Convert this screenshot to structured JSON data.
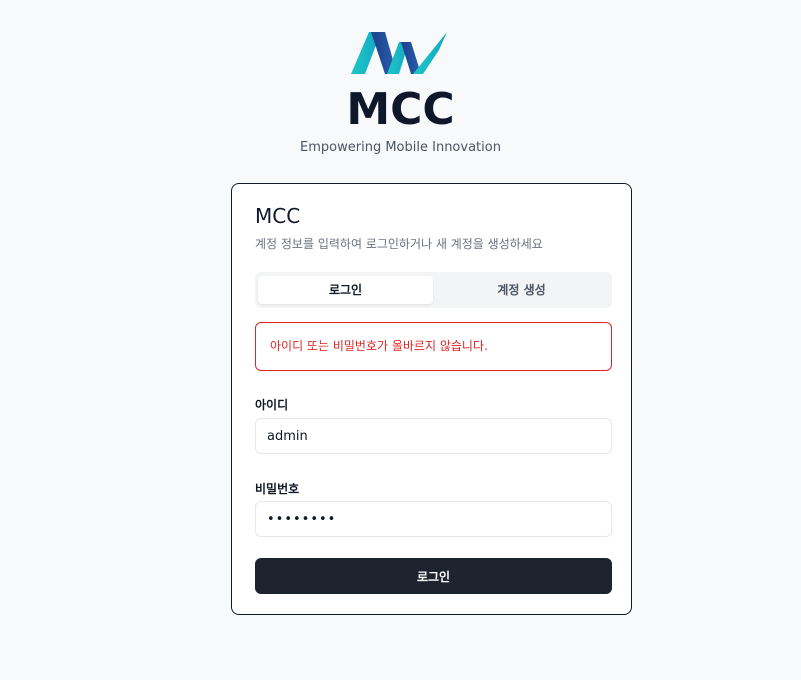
{
  "brand": {
    "title": "MCC",
    "subtitle": "Empowering Mobile Innovation",
    "logo_icon": "mcc-wave-logo",
    "logo_colors": [
      "#19b8c4",
      "#1f4fa0",
      "#2b6cc4"
    ]
  },
  "card": {
    "title": "MCC",
    "description": "계정 정보를 입력하여 로그인하거나 새 계정을 생성하세요"
  },
  "tabs": [
    {
      "label": "로그인",
      "active": true
    },
    {
      "label": "계정 생성",
      "active": false
    }
  ],
  "error": {
    "message": "아이디 또는 비밀번호가 올바르지 않습니다.",
    "color": "#dc2626"
  },
  "form": {
    "username_label": "아이디",
    "username_value": "admin",
    "password_label": "비밀번호",
    "password_value": "password",
    "submit_label": "로그인"
  },
  "colors": {
    "background": "#f8f9fb",
    "button": "#1f2330",
    "tab_track": "#f3f4f6"
  }
}
